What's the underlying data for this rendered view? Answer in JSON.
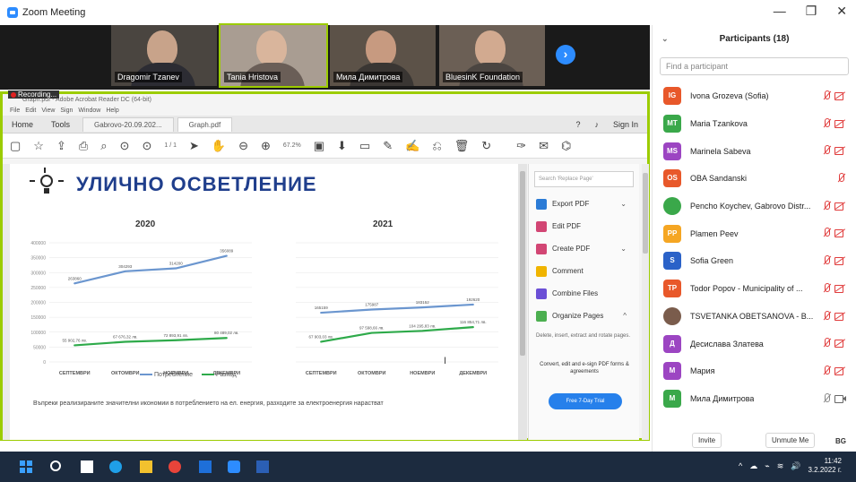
{
  "window": {
    "title": "Zoom Meeting",
    "buttons": [
      "—",
      "❐",
      "✕"
    ]
  },
  "videos": [
    {
      "name": "Dragomir Tzanev",
      "active": false
    },
    {
      "name": "Tania Hristova",
      "active": true
    },
    {
      "name": "Мила Димитрова",
      "active": false
    },
    {
      "name": "BluesinK Foundation",
      "active": false
    }
  ],
  "recording_label": "Recording...",
  "pdf": {
    "app_title": "Graph.pdf - Adobe Acrobat Reader DC (64-bit)",
    "menu": [
      "File",
      "Edit",
      "View",
      "Sign",
      "Window",
      "Help"
    ],
    "nav": [
      "Home",
      "Tools"
    ],
    "doc_tabs": [
      "Gabrovo-20.09.202...",
      "Graph.pdf"
    ],
    "sign_in": "Sign In",
    "page_counter": "1 / 1",
    "zoom": "67.2%",
    "heading": "УЛИЧНО ОСВЕТЛЕНИЕ",
    "legend": [
      "Потребление",
      "Разход"
    ],
    "footnote": "Въпреки реализираните значителни икономии в потреблението на ел. енергия, разходите за електроенергия нарастват",
    "tools": {
      "search_placeholder": "Search 'Replace Page'",
      "items": [
        {
          "label": "Export PDF",
          "color": "#2b7bd6",
          "chevron": "⌄"
        },
        {
          "label": "Edit PDF",
          "color": "#d24674",
          "chevron": ""
        },
        {
          "label": "Create PDF",
          "color": "#d24674",
          "chevron": "⌄"
        },
        {
          "label": "Comment",
          "color": "#f0b400",
          "chevron": ""
        },
        {
          "label": "Combine Files",
          "color": "#6b4fd6",
          "chevron": ""
        },
        {
          "label": "Organize Pages",
          "color": "#4caf50",
          "chevron": "^"
        }
      ],
      "description": "Delete, insert, extract and rotate pages.",
      "promo": "Convert, edit and e-sign PDF forms & agreements",
      "trial_button": "Free 7-Day Trial"
    }
  },
  "chart_data": [
    {
      "type": "line",
      "title": "2020",
      "categories": [
        "СЕПТЕМВРИ",
        "ОКТОМВРИ",
        "НОЕМВРИ",
        "ДЕКЕМВРИ"
      ],
      "yticks": [
        "400000",
        "350000",
        "300000",
        "250000",
        "200000",
        "150000",
        "100000",
        "50000",
        "0"
      ],
      "ylim": [
        0,
        400000
      ],
      "series": [
        {
          "name": "Потребление",
          "color": "#6b96cf",
          "values": [
            263860,
            304293,
            314200,
            356089
          ],
          "labels": [
            "263860",
            "304293",
            "314200",
            "356089"
          ]
        },
        {
          "name": "Разход",
          "color": "#2eaa4a",
          "values": [
            55902,
            67676,
            72893,
            80489
          ],
          "labels": [
            "55 902,76 лв.",
            "67 676,32 лв.",
            "72 893,91 лв.",
            "80 489,02 лв."
          ]
        }
      ]
    },
    {
      "type": "line",
      "title": "2021",
      "categories": [
        "СЕПТЕМВРИ",
        "ОКТОМВРИ",
        "НОЕМВРИ",
        "ДЕКЕМВРИ"
      ],
      "ylim": [
        0,
        400000
      ],
      "series": [
        {
          "name": "Потребление",
          "color": "#6b96cf",
          "values": [
            165159,
            175987,
            183152,
            192620
          ],
          "labels": [
            "165159",
            "175987",
            "183152",
            "192620"
          ]
        },
        {
          "name": "Разход",
          "color": "#2eaa4a",
          "values": [
            67903,
            97598,
            104295,
            116854
          ],
          "labels": [
            "67 903,03 лв.",
            "97 598,66 лв.",
            "104 295,83 лв.",
            "116 854,71 лв."
          ]
        }
      ]
    }
  ],
  "participants": {
    "title": "Participants (18)",
    "search_placeholder": "Find a participant",
    "list": [
      {
        "initials": "IG",
        "color": "#e8582a",
        "name": "Ivona Grozeva (Sofia)",
        "mic": "muted",
        "cam": "muted"
      },
      {
        "initials": "MT",
        "color": "#3aa84a",
        "name": "Maria Tzankova",
        "mic": "muted",
        "cam": "muted"
      },
      {
        "initials": "MS",
        "color": "#9c45c2",
        "name": "Marinela Sabeva",
        "mic": "muted",
        "cam": "muted"
      },
      {
        "initials": "OS",
        "color": "#e8582a",
        "name": "OBA Sandanski",
        "mic": "muted",
        "cam": ""
      },
      {
        "initials": "",
        "color": "#3aa84a",
        "name": "Pencho Koychev, Gabrovo Distr...",
        "mic": "muted",
        "cam": "muted"
      },
      {
        "initials": "PP",
        "color": "#f5a623",
        "name": "Plamen Peev",
        "mic": "muted",
        "cam": "muted"
      },
      {
        "initials": "S",
        "color": "#2b62c8",
        "name": "Sofia Green",
        "mic": "muted",
        "cam": "muted"
      },
      {
        "initials": "TP",
        "color": "#e8582a",
        "name": "Todor Popov - Municipality of ...",
        "mic": "muted",
        "cam": "muted"
      },
      {
        "initials": "",
        "color": "#7a5c4c",
        "name": "TSVETANKA OBETSANOVA - B...",
        "mic": "muted",
        "cam": "muted"
      },
      {
        "initials": "Д",
        "color": "#9c45c2",
        "name": "Десислава Златева",
        "mic": "muted",
        "cam": "muted"
      },
      {
        "initials": "М",
        "color": "#9c45c2",
        "name": "Мария",
        "mic": "muted",
        "cam": "muted"
      },
      {
        "initials": "M",
        "color": "#3aa84a",
        "name": "Мила Димитрова",
        "mic": "muted-gray",
        "cam": "on"
      }
    ],
    "invite": "Invite",
    "unmute_me": "Unmute Me",
    "lang": "BG"
  },
  "taskbar": {
    "time": "11:42",
    "date": "3.2.2022 г."
  }
}
